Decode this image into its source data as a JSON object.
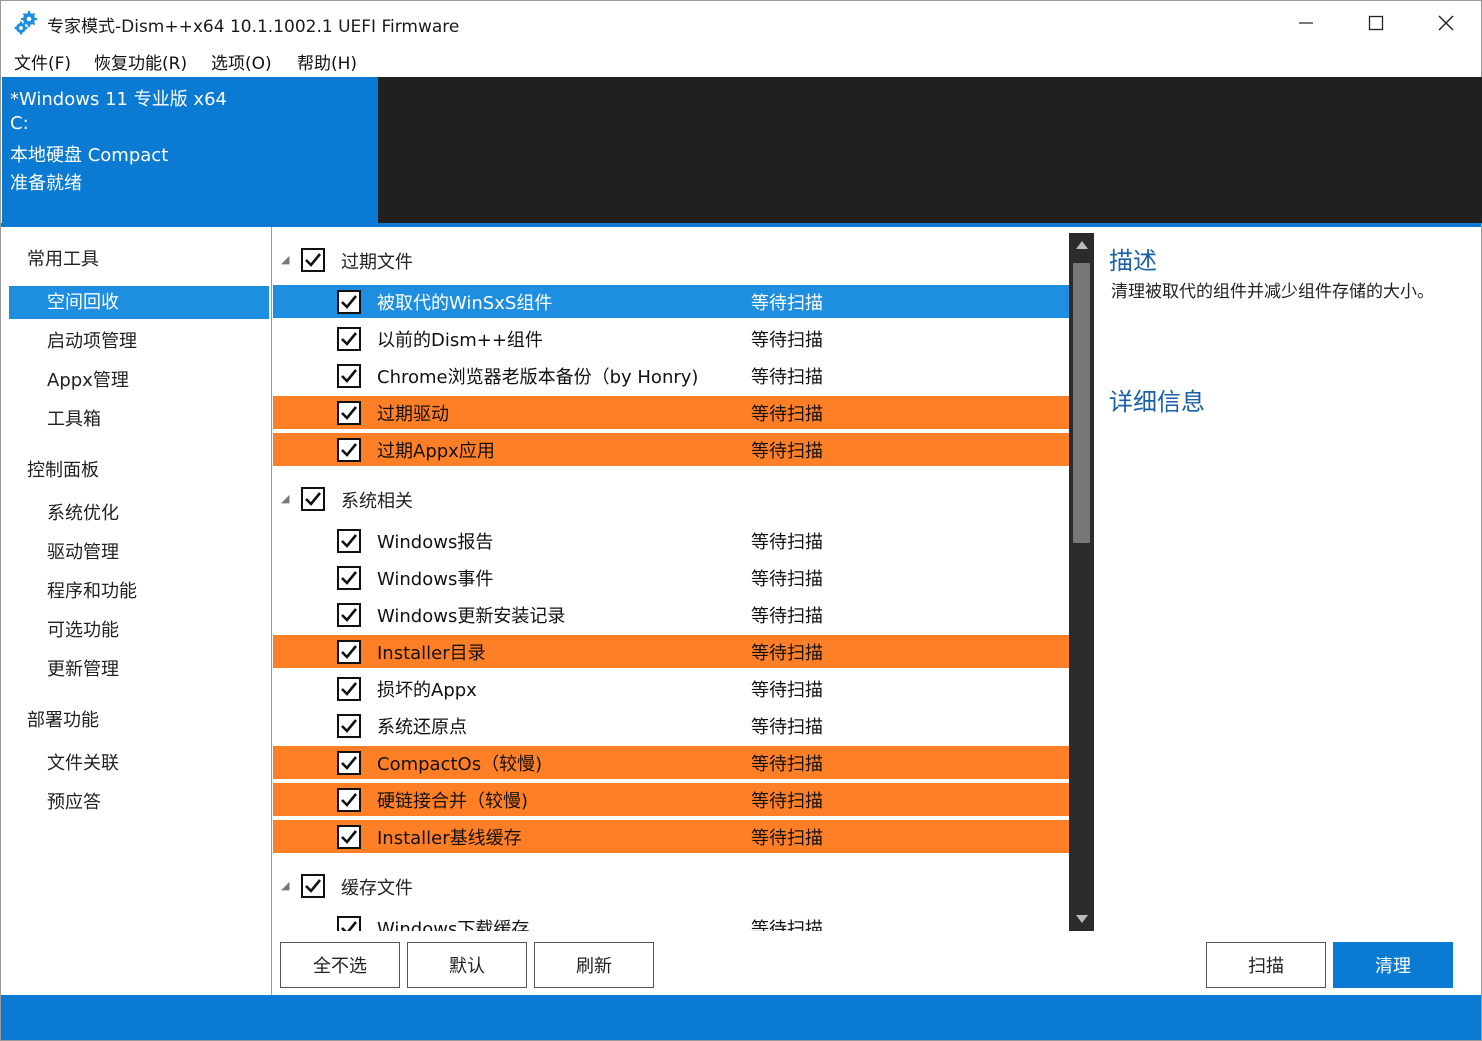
{
  "window": {
    "title": "专家模式-Dism++x64 10.1.1002.1 UEFI Firmware",
    "accent_color": "#0a7ad2",
    "warn_color": "#ff7f27"
  },
  "menu": [
    "文件(F)",
    "恢复功能(R)",
    "选项(O)",
    "帮助(H)"
  ],
  "banner": {
    "os": "*Windows 11 专业版 x64",
    "drive": "C:",
    "disk": "本地硬盘 Compact",
    "status": "准备就绪"
  },
  "nav": {
    "sections": [
      {
        "title": "常用工具",
        "items": [
          "空间回收",
          "启动项管理",
          "Appx管理",
          "工具箱"
        ]
      },
      {
        "title": "控制面板",
        "items": [
          "系统优化",
          "驱动管理",
          "程序和功能",
          "可选功能",
          "更新管理"
        ]
      },
      {
        "title": "部署功能",
        "items": [
          "文件关联",
          "预应答"
        ]
      }
    ],
    "active": "空间回收"
  },
  "groups": [
    {
      "label": "过期文件",
      "checked": true,
      "items": [
        {
          "label": "被取代的WinSxS组件",
          "status": "等待扫描",
          "checked": true,
          "state": "selected"
        },
        {
          "label": "以前的Dism++组件",
          "status": "等待扫描",
          "checked": true,
          "state": "normal"
        },
        {
          "label": "Chrome浏览器老版本备份（by Honry)",
          "status": "等待扫描",
          "checked": true,
          "state": "normal"
        },
        {
          "label": "过期驱动",
          "status": "等待扫描",
          "checked": true,
          "state": "warn"
        },
        {
          "label": "过期Appx应用",
          "status": "等待扫描",
          "checked": true,
          "state": "warn"
        }
      ]
    },
    {
      "label": "系统相关",
      "checked": true,
      "items": [
        {
          "label": "Windows报告",
          "status": "等待扫描",
          "checked": true,
          "state": "normal"
        },
        {
          "label": "Windows事件",
          "status": "等待扫描",
          "checked": true,
          "state": "normal"
        },
        {
          "label": "Windows更新安装记录",
          "status": "等待扫描",
          "checked": true,
          "state": "normal"
        },
        {
          "label": "Installer目录",
          "status": "等待扫描",
          "checked": true,
          "state": "warn"
        },
        {
          "label": "损坏的Appx",
          "status": "等待扫描",
          "checked": true,
          "state": "normal"
        },
        {
          "label": "系统还原点",
          "status": "等待扫描",
          "checked": true,
          "state": "normal"
        },
        {
          "label": "CompactOs（较慢)",
          "status": "等待扫描",
          "checked": true,
          "state": "warn"
        },
        {
          "label": "硬链接合并（较慢)",
          "status": "等待扫描",
          "checked": true,
          "state": "warn"
        },
        {
          "label": "Installer基线缓存",
          "status": "等待扫描",
          "checked": true,
          "state": "warn"
        }
      ]
    },
    {
      "label": "缓存文件",
      "checked": true,
      "items": [
        {
          "label": "Windows下载缓存",
          "status": "等待扫描",
          "checked": true,
          "state": "normal"
        }
      ]
    }
  ],
  "description": {
    "title": "描述",
    "text": "清理被取代的组件并减少组件存储的大小。",
    "detail_title": "详细信息"
  },
  "buttons": {
    "select_none": "全不选",
    "default": "默认",
    "refresh": "刷新",
    "scan": "扫描",
    "clean": "清理"
  }
}
